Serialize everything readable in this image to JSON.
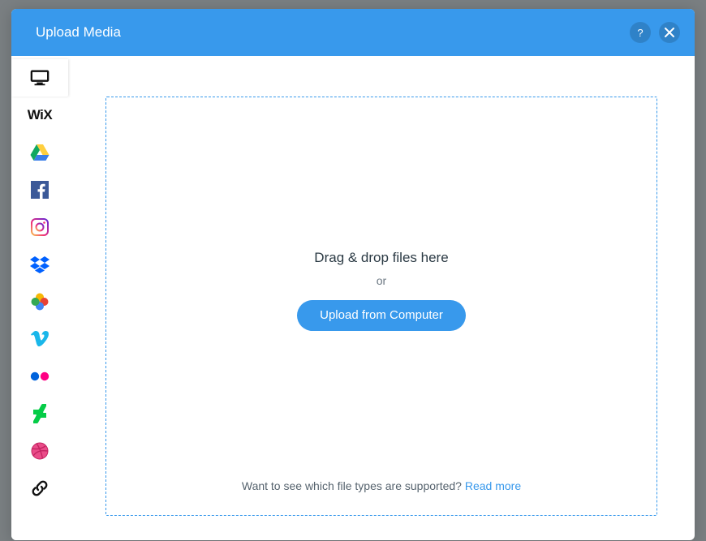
{
  "header": {
    "title": "Upload Media",
    "help_label": "?",
    "close_label": "Close"
  },
  "sidebar": {
    "items": [
      {
        "id": "computer",
        "label": "My Computer"
      },
      {
        "id": "wix",
        "label": "Free from Wix"
      },
      {
        "id": "google-drive",
        "label": "Google Drive"
      },
      {
        "id": "facebook",
        "label": "Facebook"
      },
      {
        "id": "instagram",
        "label": "Instagram"
      },
      {
        "id": "dropbox",
        "label": "Dropbox"
      },
      {
        "id": "google-photos",
        "label": "Google Photos"
      },
      {
        "id": "vimeo",
        "label": "Vimeo"
      },
      {
        "id": "flickr",
        "label": "Flickr"
      },
      {
        "id": "deviantart",
        "label": "DeviantArt"
      },
      {
        "id": "dribbble",
        "label": "Dribbble"
      },
      {
        "id": "url",
        "label": "Link (URL)"
      }
    ],
    "active": "computer"
  },
  "main": {
    "drag_text": "Drag & drop files here",
    "or_text": "or",
    "upload_button": "Upload from Computer",
    "supported_question": "Want to see which file types are supported? ",
    "read_more": "Read more"
  }
}
